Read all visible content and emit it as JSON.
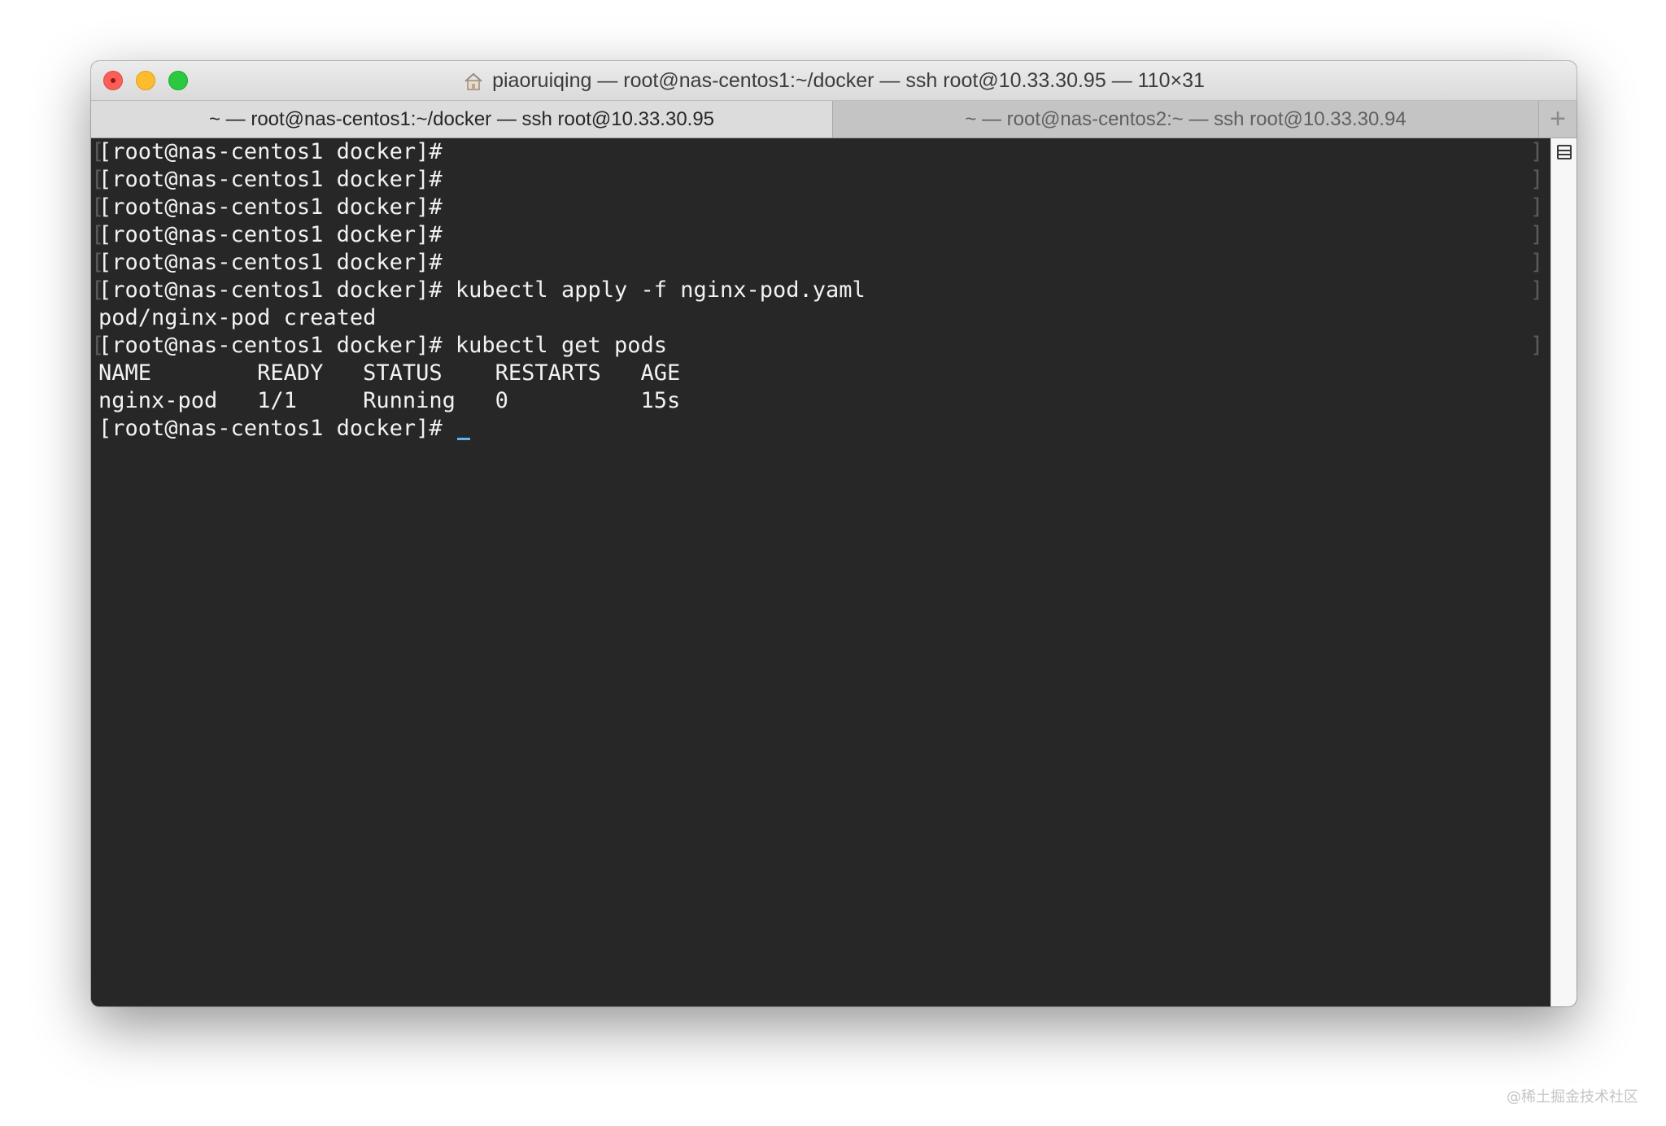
{
  "window": {
    "title": "piaoruiqing — root@nas-centos1:~/docker — ssh root@10.33.30.95 — 110×31"
  },
  "tabs": [
    {
      "label": "~ — root@nas-centos1:~/docker — ssh root@10.33.30.95",
      "active": true
    },
    {
      "label": "~ — root@nas-centos2:~ — ssh root@10.33.30.94",
      "active": false
    }
  ],
  "new_tab_label": "+",
  "terminal": {
    "lines": [
      "[root@nas-centos1 docker]#",
      "[root@nas-centos1 docker]#",
      "[root@nas-centos1 docker]#",
      "[root@nas-centos1 docker]#",
      "[root@nas-centos1 docker]#",
      "[root@nas-centos1 docker]# kubectl apply -f nginx-pod.yaml",
      "pod/nginx-pod created",
      "[root@nas-centos1 docker]# kubectl get pods",
      "NAME        READY   STATUS    RESTARTS   AGE",
      "nginx-pod   1/1     Running   0          15s",
      "[root@nas-centos1 docker]# "
    ],
    "cursor_color": "#5fb3f0"
  },
  "watermark": "@稀土掘金技术社区",
  "colors": {
    "terminal_bg": "#272727",
    "close": "#fc5f57",
    "minimize": "#fdbc2e",
    "maximize": "#2ac940"
  }
}
